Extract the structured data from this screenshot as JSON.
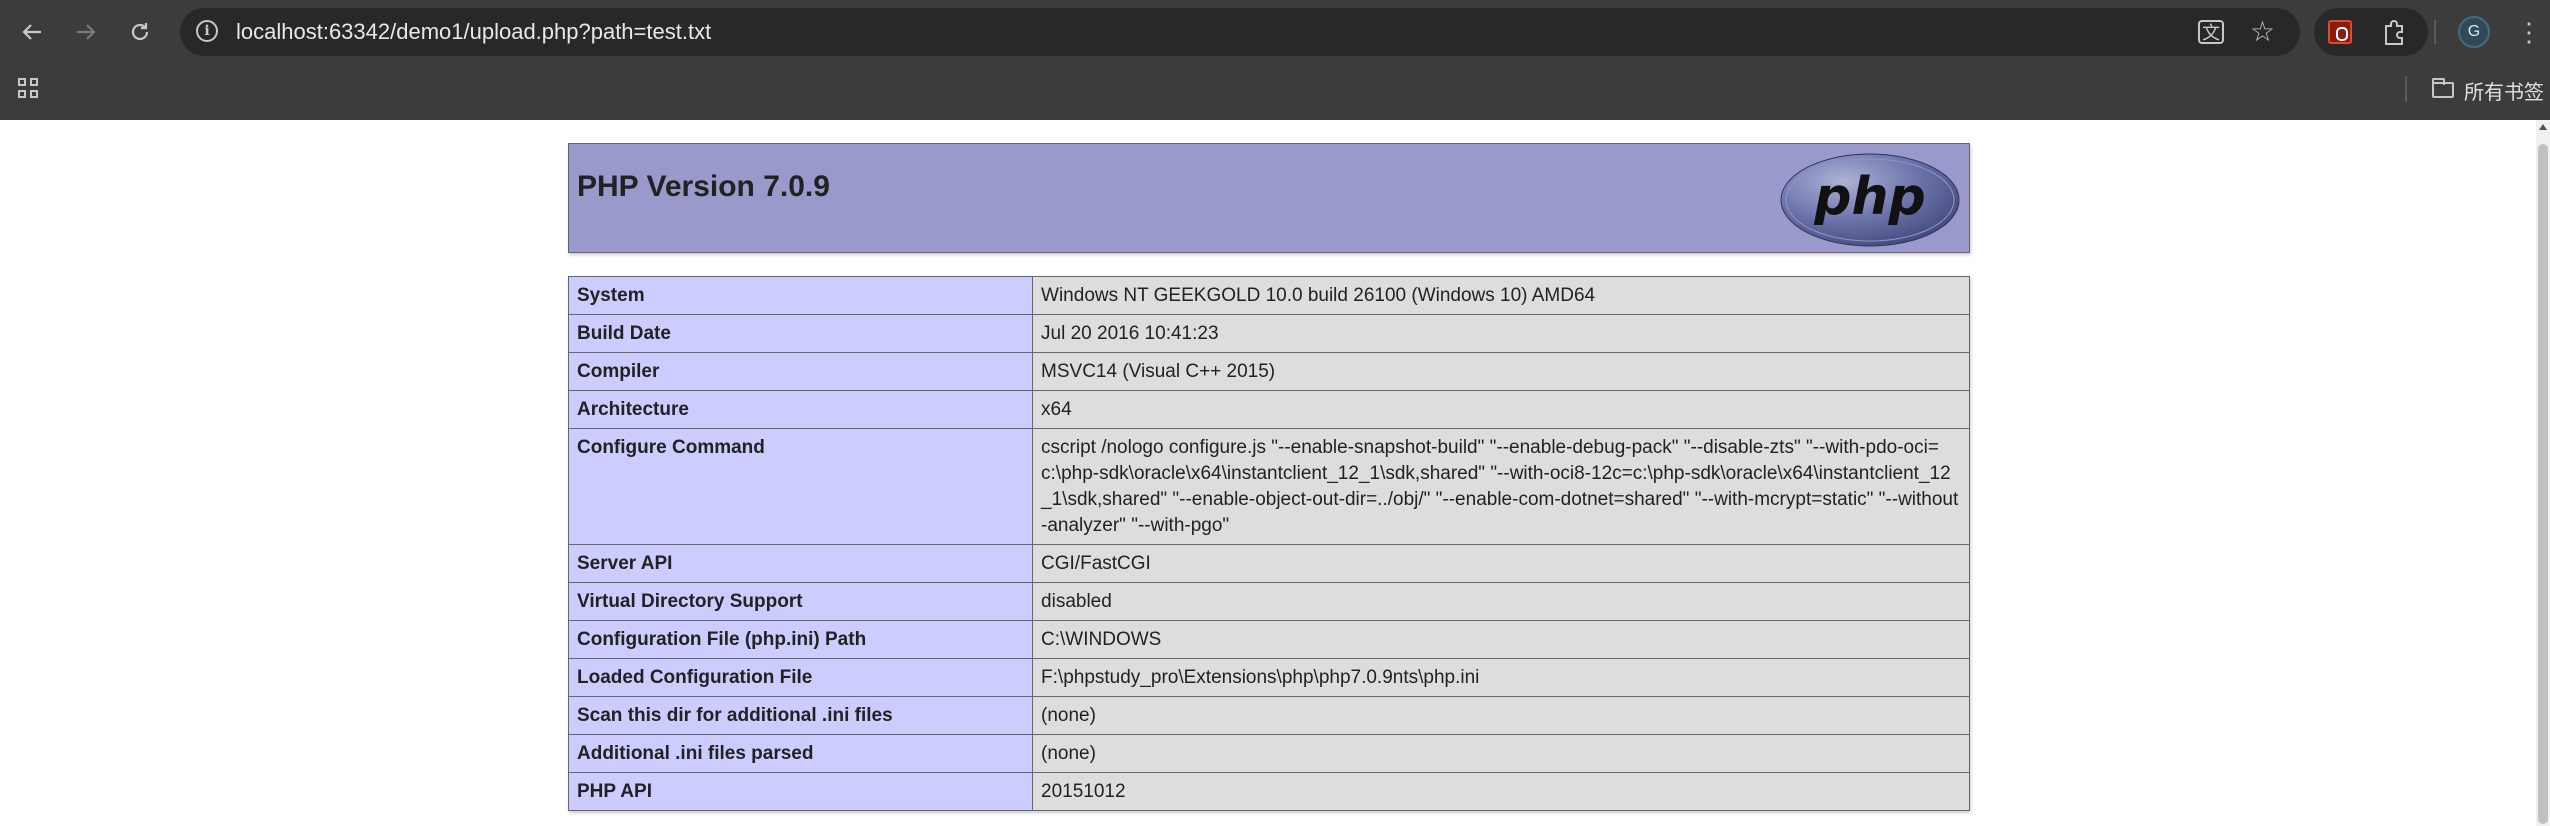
{
  "browser": {
    "url": "localhost:63342/demo1/upload.php?path=test.txt",
    "back_icon": "arrow-left",
    "forward_icon": "arrow-right",
    "reload_icon": "reload",
    "avatar_letter": "G",
    "bookmarks_label": "所有书签"
  },
  "page": {
    "title": "PHP Version 7.0.9",
    "logo_text": "php",
    "colors": {
      "header_bg": "#9999cc",
      "key_bg": "#ccccff",
      "value_bg": "#dddddd"
    },
    "rows": [
      {
        "key": "System",
        "value": "Windows NT GEEKGOLD 10.0 build 26100 (Windows 10) AMD64"
      },
      {
        "key": "Build Date",
        "value": "Jul 20 2016 10:41:23"
      },
      {
        "key": "Compiler",
        "value": "MSVC14 (Visual C++ 2015)"
      },
      {
        "key": "Architecture",
        "value": "x64"
      },
      {
        "key": "Configure Command",
        "value": "cscript /nologo configure.js \"--enable-snapshot-build\" \"--enable-debug-pack\" \"--disable-zts\" \"--with-pdo-oci=c:\\php-sdk\\oracle\\x64\\instantclient_12_1\\sdk,shared\" \"--with-oci8-12c=c:\\php-sdk\\oracle\\x64\\instantclient_12_1\\sdk,shared\" \"--enable-object-out-dir=../obj/\" \"--enable-com-dotnet=shared\" \"--with-mcrypt=static\" \"--without-analyzer\" \"--with-pgo\""
      },
      {
        "key": "Server API",
        "value": "CGI/FastCGI"
      },
      {
        "key": "Virtual Directory Support",
        "value": "disabled"
      },
      {
        "key": "Configuration File (php.ini) Path",
        "value": "C:\\WINDOWS"
      },
      {
        "key": "Loaded Configuration File",
        "value": "F:\\phpstudy_pro\\Extensions\\php\\php7.0.9nts\\php.ini"
      },
      {
        "key": "Scan this dir for additional .ini files",
        "value": "(none)"
      },
      {
        "key": "Additional .ini files parsed",
        "value": "(none)"
      },
      {
        "key": "PHP API",
        "value": "20151012"
      }
    ]
  }
}
